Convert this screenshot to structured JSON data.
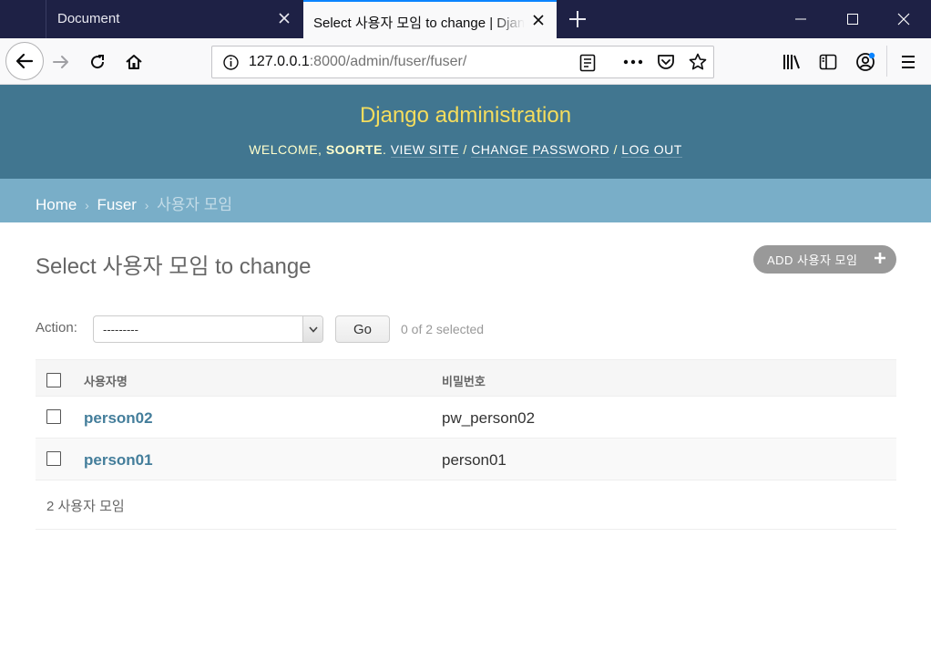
{
  "browser": {
    "tabs": [
      {
        "title": "Document",
        "active": false
      },
      {
        "title": "Select 사용자 모임 to change | Django site admin",
        "active": true
      }
    ],
    "url": {
      "host": "127.0.0.1",
      "rest": ":8000/admin/fuser/fuser/"
    }
  },
  "admin": {
    "branding": "Django administration",
    "user_tools": {
      "welcome": "WELCOME, ",
      "username": "SOORTE",
      "period": ". ",
      "view_site": "VIEW SITE",
      "sep1": " / ",
      "change_password": "CHANGE PASSWORD",
      "sep2": " / ",
      "logout": "LOG OUT"
    },
    "breadcrumbs": {
      "home": "Home",
      "app": "Fuser",
      "current": "사용자 모임",
      "separator": "›"
    },
    "title": "Select 사용자 모임 to change",
    "add_button": "ADD 사용자 모임",
    "actions": {
      "label": "Action:",
      "selected_option": "---------",
      "go": "Go",
      "counter": "0 of 2 selected"
    },
    "table": {
      "columns": [
        "사용자명",
        "비밀번호"
      ],
      "rows": [
        {
          "username": "person02",
          "password": "pw_person02"
        },
        {
          "username": "person01",
          "password": "person01"
        }
      ]
    },
    "paginator": "2 사용자 모임"
  },
  "colors": {
    "header": "#417690",
    "breadcrumbs": "#79aec8",
    "branding": "#f5dd5d",
    "link": "#447e9b",
    "tab_accent": "#0a84ff"
  }
}
